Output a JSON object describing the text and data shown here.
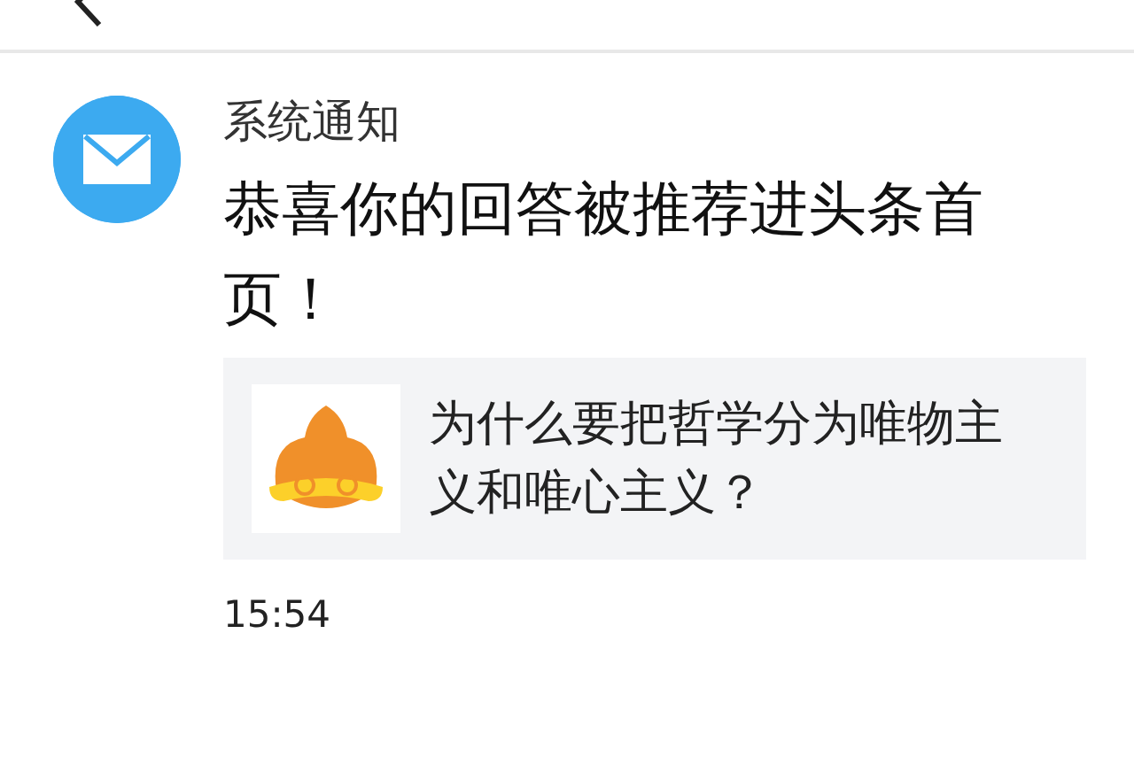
{
  "message": {
    "sender": "系统通知",
    "text": "恭喜你的回答被推荐进头条首页！",
    "attachment": {
      "title": "为什么要把哲学分为唯物主义和唯心主义？"
    },
    "time": "15:54"
  }
}
